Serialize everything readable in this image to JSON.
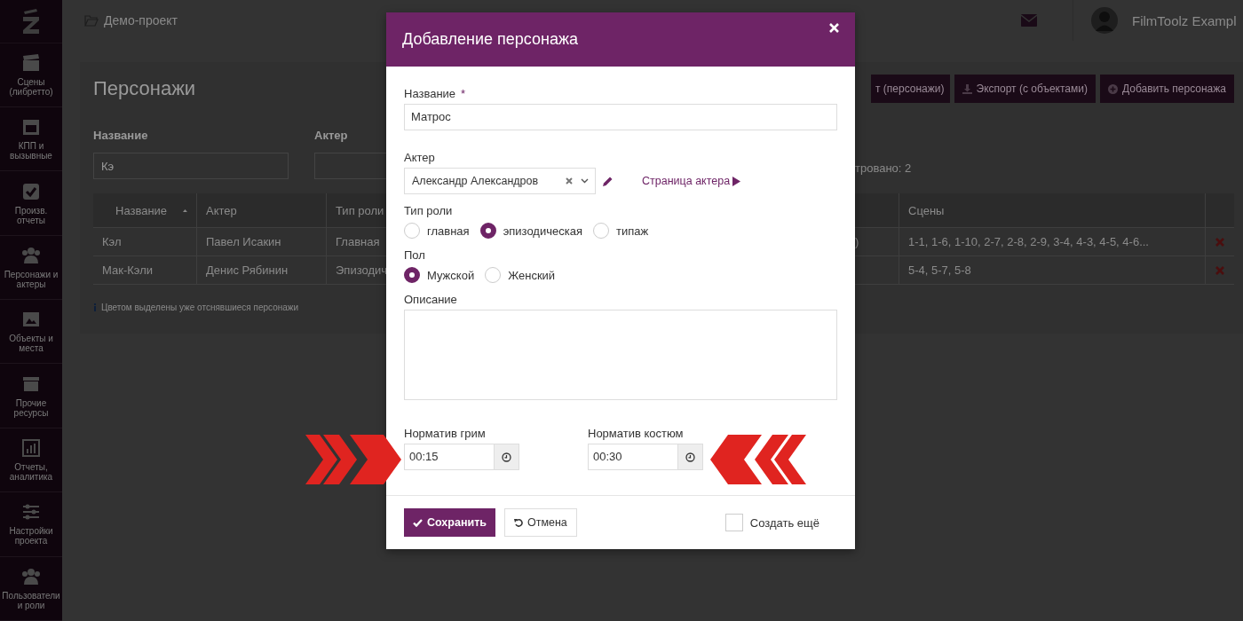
{
  "sidebar": {
    "items": [
      {
        "label": "Сцены (либретто)"
      },
      {
        "label": "КПП и вызывные"
      },
      {
        "label": "Произв. отчеты"
      },
      {
        "label": "Персонажи и актеры"
      },
      {
        "label": "Объекты и места"
      },
      {
        "label": "Прочие ресурсы"
      },
      {
        "label": "Отчеты, аналитика"
      },
      {
        "label": "Настройки проекта"
      },
      {
        "label": "Пользователи и роли"
      }
    ]
  },
  "topbar": {
    "project": "Демо-проект",
    "user": "FilmToolz Exampl"
  },
  "page": {
    "title": "Персонажи",
    "buttons": [
      {
        "label": "т (персонажи)"
      },
      {
        "label": "Экспорт (с объектами)"
      },
      {
        "label": "Добавить персонажа"
      }
    ],
    "filters": [
      {
        "label": "Название",
        "value": "Кэ"
      },
      {
        "label": "Актер"
      }
    ],
    "filtered_count": "тровано: 2",
    "table": {
      "columns": [
        {
          "label": "Название",
          "sorted": true
        },
        {
          "label": "Актер"
        },
        {
          "label": "Тип роли"
        },
        {
          "label": "Сцены"
        }
      ],
      "rows": [
        {
          "name": "Кэл",
          "actor": "Павел Исакин",
          "role_type": "Главная",
          "column_4": ")",
          "scenes": "1-1, 1-6, 1-10, 2-7, 2-8, 2-9, 3-4, 4-3, 4-5, 4-6..."
        },
        {
          "name": "Мак-Кэли",
          "actor": "Денис Рябинин",
          "role_type": "Эпизодич",
          "scenes": "5-4, 5-7, 5-8"
        }
      ]
    },
    "note": "Цветом выделены уже отснявшиеся персонажи"
  },
  "modal": {
    "title": "Добавление персонажа",
    "name": {
      "label": "Название",
      "required_mark": "*",
      "value": "Матрос"
    },
    "actor": {
      "label": "Актер",
      "value": "Александр Александров",
      "link": "Страница актера"
    },
    "role_type": {
      "label": "Тип роли",
      "options": [
        {
          "label": "главная",
          "selected": false
        },
        {
          "label": "эпизодическая",
          "selected": true
        },
        {
          "label": "типаж",
          "selected": false
        }
      ]
    },
    "gender": {
      "label": "Пол",
      "options": [
        {
          "label": "Мужской",
          "selected": true
        },
        {
          "label": "Женский",
          "selected": false
        }
      ]
    },
    "description": {
      "label": "Описание"
    },
    "times": [
      {
        "label": "Норматив грим",
        "value": "00:15"
      },
      {
        "label": "Норматив костюм",
        "value": "00:30"
      }
    ],
    "buttons": [
      {
        "label": "Сохранить",
        "kind": "primary"
      },
      {
        "label": "Отмена",
        "kind": "default"
      }
    ],
    "create_more": {
      "label": "Создать ещё",
      "checked": false
    }
  }
}
